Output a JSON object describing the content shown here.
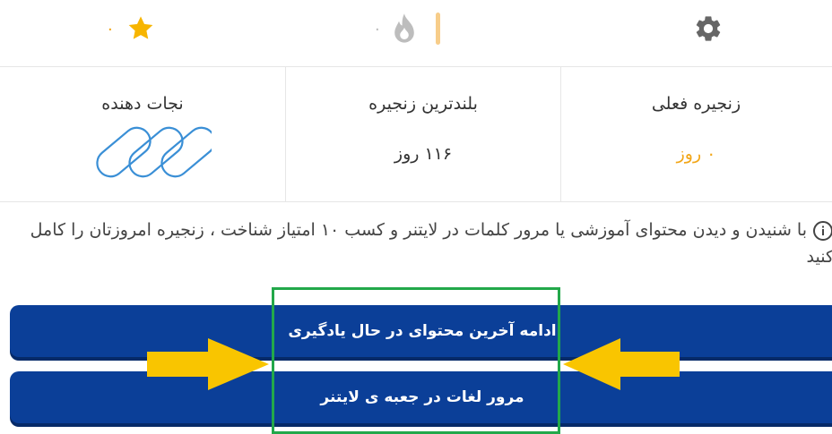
{
  "topbar": {
    "stars_count": "۰",
    "fire_count": "۰",
    "star_color": "#f7b500",
    "fire_color": "#bdbdbd",
    "gear_color": "#666666"
  },
  "stats": {
    "current_streak": {
      "label": "زنجیره فعلی",
      "value": "۰ روز"
    },
    "longest_streak": {
      "label": "بلندترین زنجیره",
      "value": "۱۱۶ روز"
    },
    "savers": {
      "label": "نجات دهنده"
    }
  },
  "info": {
    "text": "با شنیدن و دیدن محتوای آموزشی یا مرور کلمات در لایتنر و کسب ۱۰ امتیاز شناخت ، زنجیره امروزتان را کامل کنید"
  },
  "buttons": {
    "continue_label": "ادامه آخرین محتوای در حال یادگیری",
    "review_label": "مرور لغات در جعبه ی لایتنر"
  },
  "colors": {
    "button_bg": "#0b3f98",
    "accent_orange": "#f2a618",
    "highlight_green": "#22a84a",
    "arrow_yellow": "#f9c500"
  }
}
